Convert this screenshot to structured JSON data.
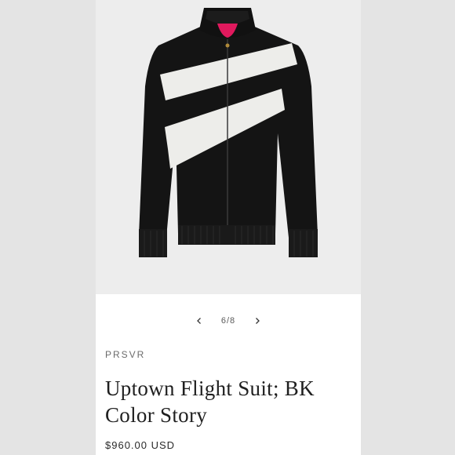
{
  "product": {
    "image_alt": "Black bomber jacket with white diagonal stripes",
    "gallery": {
      "prev_icon": "chevron-left-icon",
      "next_icon": "chevron-right-icon",
      "counter": "6/8"
    },
    "vendor": "PRSVR",
    "title": "Uptown Flight Suit; BK Color Story",
    "price": "$960.00 USD"
  },
  "colors": {
    "page_bg": "#e4e4e4",
    "card_bg": "#ffffff",
    "jacket": "#141414",
    "stripe": "#ededea",
    "lining": "#e0195d"
  }
}
